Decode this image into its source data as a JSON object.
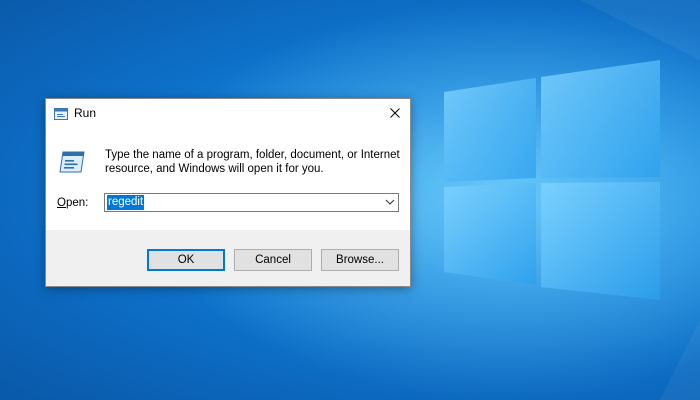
{
  "desktop": {
    "wallpaper": "windows-10-logo-wallpaper",
    "accent_color": "#0078d7"
  },
  "dialog": {
    "title": "Run",
    "title_icon": "run-icon",
    "close_icon": "close-icon",
    "icon": "run-program-icon",
    "description": "Type the name of a program, folder, document, or Internet resource, and Windows will open it for you.",
    "open_label_accel": "O",
    "open_label_rest": "pen:",
    "input_value": "regedit",
    "input_selected": true,
    "dropdown_icon": "chevron-down-icon",
    "buttons": {
      "ok": "OK",
      "cancel": "Cancel",
      "browse": "Browse..."
    }
  }
}
